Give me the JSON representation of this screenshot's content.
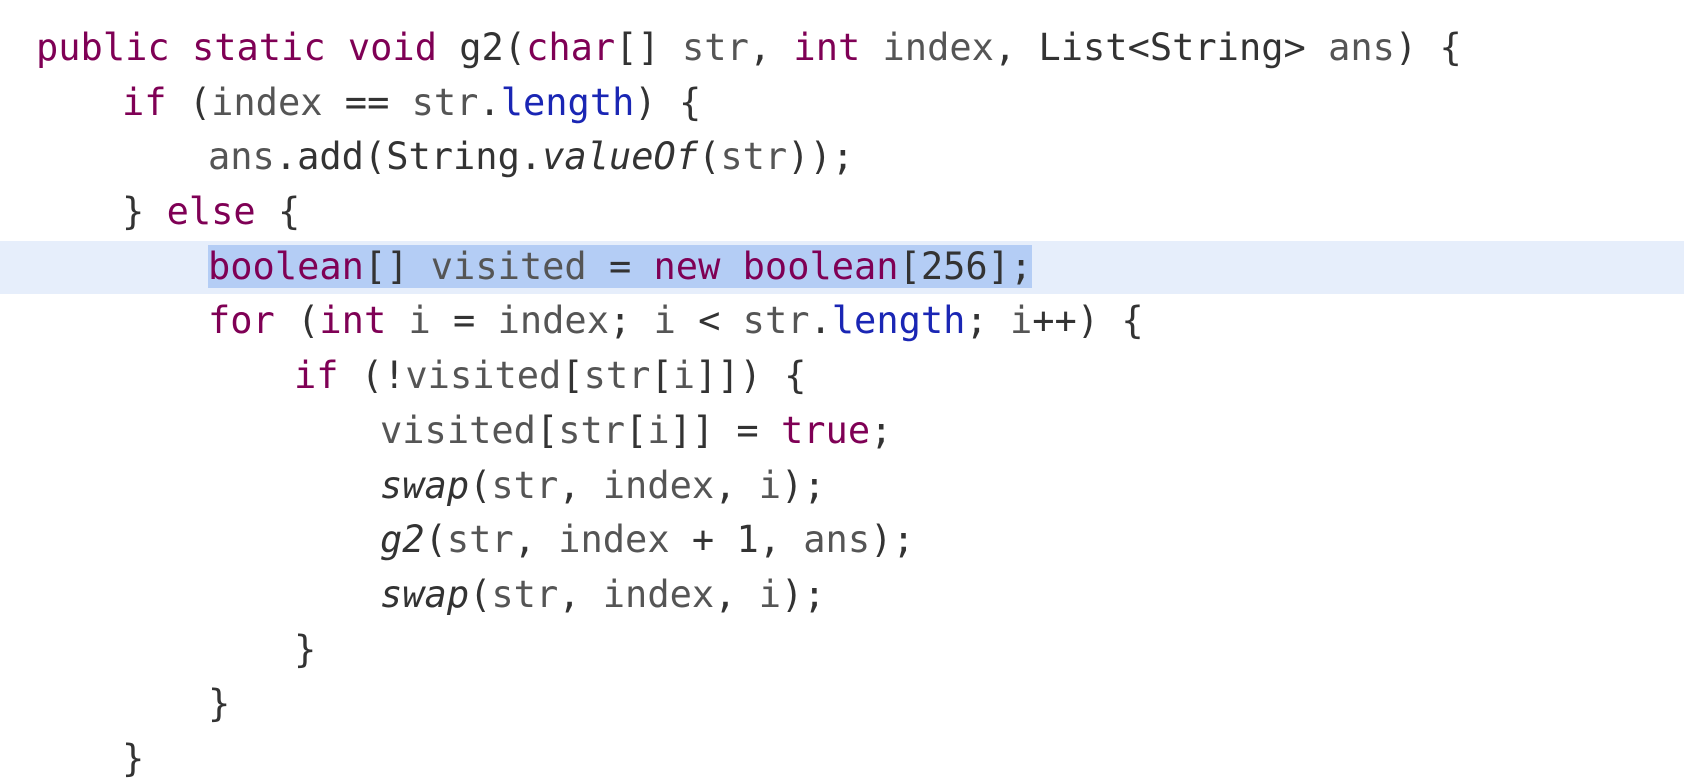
{
  "editor": {
    "highlighted_line_index": 4,
    "lines": [
      {
        "indent": "",
        "tokens": [
          {
            "t": "public",
            "c": "kw"
          },
          {
            "t": " ",
            "c": "txt"
          },
          {
            "t": "static",
            "c": "kw"
          },
          {
            "t": " ",
            "c": "txt"
          },
          {
            "t": "void",
            "c": "kw"
          },
          {
            "t": " g2(",
            "c": "txt"
          },
          {
            "t": "char",
            "c": "kw"
          },
          {
            "t": "[] ",
            "c": "txt"
          },
          {
            "t": "str",
            "c": "var"
          },
          {
            "t": ", ",
            "c": "txt"
          },
          {
            "t": "int",
            "c": "kw"
          },
          {
            "t": " ",
            "c": "txt"
          },
          {
            "t": "index",
            "c": "var"
          },
          {
            "t": ", List<String> ",
            "c": "txt"
          },
          {
            "t": "ans",
            "c": "var"
          },
          {
            "t": ") {",
            "c": "txt"
          }
        ]
      },
      {
        "indent": "  ",
        "tokens": [
          {
            "t": "if",
            "c": "kw"
          },
          {
            "t": " (",
            "c": "txt"
          },
          {
            "t": "index",
            "c": "var"
          },
          {
            "t": " == ",
            "c": "txt"
          },
          {
            "t": "str",
            "c": "var"
          },
          {
            "t": ".",
            "c": "txt"
          },
          {
            "t": "length",
            "c": "field"
          },
          {
            "t": ") {",
            "c": "txt"
          }
        ]
      },
      {
        "indent": "    ",
        "tokens": [
          {
            "t": "ans",
            "c": "var"
          },
          {
            "t": ".add(String.",
            "c": "txt"
          },
          {
            "t": "valueOf",
            "c": "txt ital"
          },
          {
            "t": "(",
            "c": "txt"
          },
          {
            "t": "str",
            "c": "var"
          },
          {
            "t": "));",
            "c": "txt"
          }
        ]
      },
      {
        "indent": "  ",
        "tokens": [
          {
            "t": "} ",
            "c": "txt"
          },
          {
            "t": "else",
            "c": "kw"
          },
          {
            "t": " {",
            "c": "txt"
          }
        ]
      },
      {
        "indent": "    ",
        "selected": true,
        "tokens": [
          {
            "t": "boolean",
            "c": "kw"
          },
          {
            "t": "[] ",
            "c": "txt"
          },
          {
            "t": "visited",
            "c": "var"
          },
          {
            "t": " = ",
            "c": "txt"
          },
          {
            "t": "new",
            "c": "kw"
          },
          {
            "t": " ",
            "c": "txt"
          },
          {
            "t": "boolean",
            "c": "kw"
          },
          {
            "t": "[256];",
            "c": "txt"
          }
        ]
      },
      {
        "indent": "    ",
        "tokens": [
          {
            "t": "for",
            "c": "kw"
          },
          {
            "t": " (",
            "c": "txt"
          },
          {
            "t": "int",
            "c": "kw"
          },
          {
            "t": " ",
            "c": "txt"
          },
          {
            "t": "i",
            "c": "var"
          },
          {
            "t": " = ",
            "c": "txt"
          },
          {
            "t": "index",
            "c": "var"
          },
          {
            "t": "; ",
            "c": "txt"
          },
          {
            "t": "i",
            "c": "var"
          },
          {
            "t": " < ",
            "c": "txt"
          },
          {
            "t": "str",
            "c": "var"
          },
          {
            "t": ".",
            "c": "txt"
          },
          {
            "t": "length",
            "c": "field"
          },
          {
            "t": "; ",
            "c": "txt"
          },
          {
            "t": "i",
            "c": "var"
          },
          {
            "t": "++) {",
            "c": "txt"
          }
        ]
      },
      {
        "indent": "      ",
        "tokens": [
          {
            "t": "if",
            "c": "kw"
          },
          {
            "t": " (!",
            "c": "txt"
          },
          {
            "t": "visited",
            "c": "var"
          },
          {
            "t": "[",
            "c": "txt"
          },
          {
            "t": "str",
            "c": "var"
          },
          {
            "t": "[",
            "c": "txt"
          },
          {
            "t": "i",
            "c": "var"
          },
          {
            "t": "]]) {",
            "c": "txt"
          }
        ]
      },
      {
        "indent": "        ",
        "tokens": [
          {
            "t": "visited",
            "c": "var"
          },
          {
            "t": "[",
            "c": "txt"
          },
          {
            "t": "str",
            "c": "var"
          },
          {
            "t": "[",
            "c": "txt"
          },
          {
            "t": "i",
            "c": "var"
          },
          {
            "t": "]] = ",
            "c": "txt"
          },
          {
            "t": "true",
            "c": "kw"
          },
          {
            "t": ";",
            "c": "txt"
          }
        ]
      },
      {
        "indent": "        ",
        "tokens": [
          {
            "t": "swap",
            "c": "txt ital"
          },
          {
            "t": "(",
            "c": "txt"
          },
          {
            "t": "str",
            "c": "var"
          },
          {
            "t": ", ",
            "c": "txt"
          },
          {
            "t": "index",
            "c": "var"
          },
          {
            "t": ", ",
            "c": "txt"
          },
          {
            "t": "i",
            "c": "var"
          },
          {
            "t": ");",
            "c": "txt"
          }
        ]
      },
      {
        "indent": "        ",
        "tokens": [
          {
            "t": "g2",
            "c": "txt ital"
          },
          {
            "t": "(",
            "c": "txt"
          },
          {
            "t": "str",
            "c": "var"
          },
          {
            "t": ", ",
            "c": "txt"
          },
          {
            "t": "index",
            "c": "var"
          },
          {
            "t": " + 1, ",
            "c": "txt"
          },
          {
            "t": "ans",
            "c": "var"
          },
          {
            "t": ");",
            "c": "txt"
          }
        ]
      },
      {
        "indent": "        ",
        "tokens": [
          {
            "t": "swap",
            "c": "txt ital"
          },
          {
            "t": "(",
            "c": "txt"
          },
          {
            "t": "str",
            "c": "var"
          },
          {
            "t": ", ",
            "c": "txt"
          },
          {
            "t": "index",
            "c": "var"
          },
          {
            "t": ", ",
            "c": "txt"
          },
          {
            "t": "i",
            "c": "var"
          },
          {
            "t": ");",
            "c": "txt"
          }
        ]
      },
      {
        "indent": "      ",
        "tokens": [
          {
            "t": "}",
            "c": "txt"
          }
        ]
      },
      {
        "indent": "    ",
        "tokens": [
          {
            "t": "}",
            "c": "txt"
          }
        ]
      },
      {
        "indent": "  ",
        "tokens": [
          {
            "t": "}",
            "c": "txt"
          }
        ]
      }
    ]
  },
  "colors": {
    "keyword": "#7f0055",
    "field": "#1a26b4",
    "selection": "#b4cdf5",
    "line_highlight": "#e6eefb"
  }
}
